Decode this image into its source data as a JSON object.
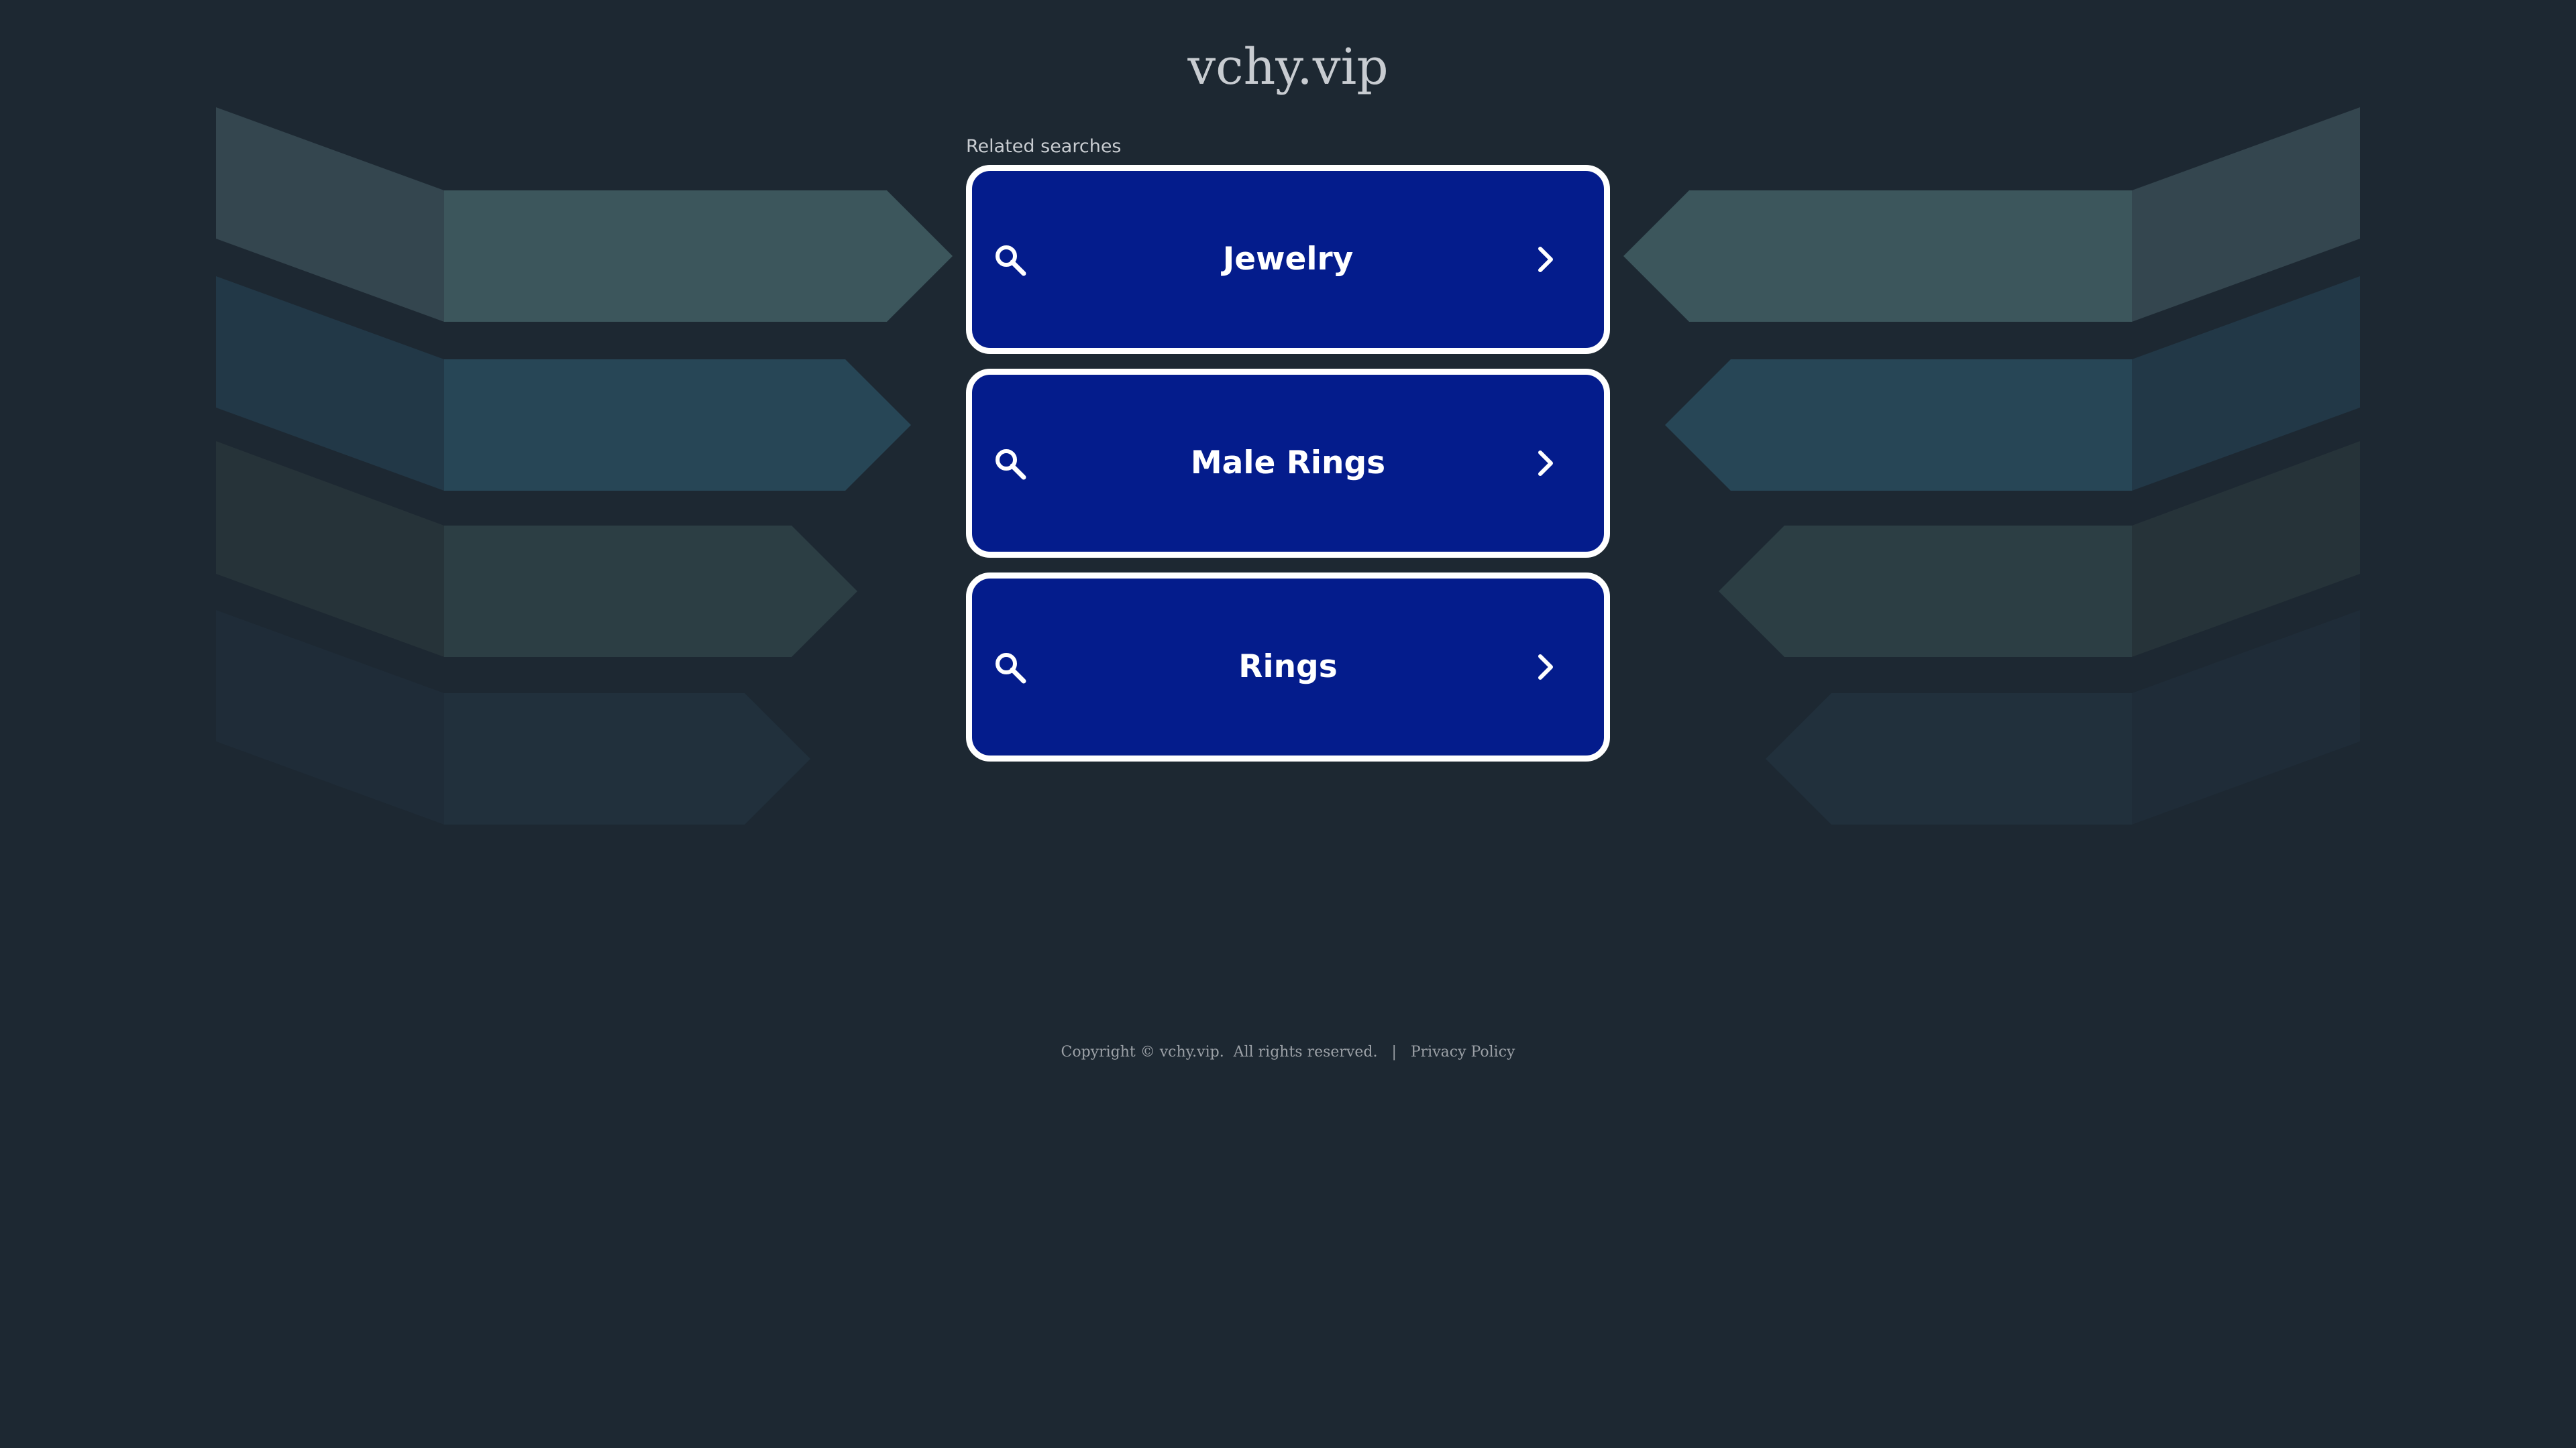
{
  "site": {
    "domain": "vchy.vip"
  },
  "related": {
    "label": "Related searches",
    "items": [
      {
        "label": "Jewelry"
      },
      {
        "label": "Male Rings"
      },
      {
        "label": "Rings"
      }
    ]
  },
  "footer": {
    "copyright": "Copyright © vchy.vip.  All rights reserved.",
    "separator": "|",
    "privacy_label": "Privacy Policy"
  },
  "colors": {
    "background": "#1d2832",
    "button_fill": "#041c8c",
    "button_border": "#ffffff"
  },
  "icons": {
    "search": "search-icon",
    "chevron": "chevron-right-icon"
  }
}
